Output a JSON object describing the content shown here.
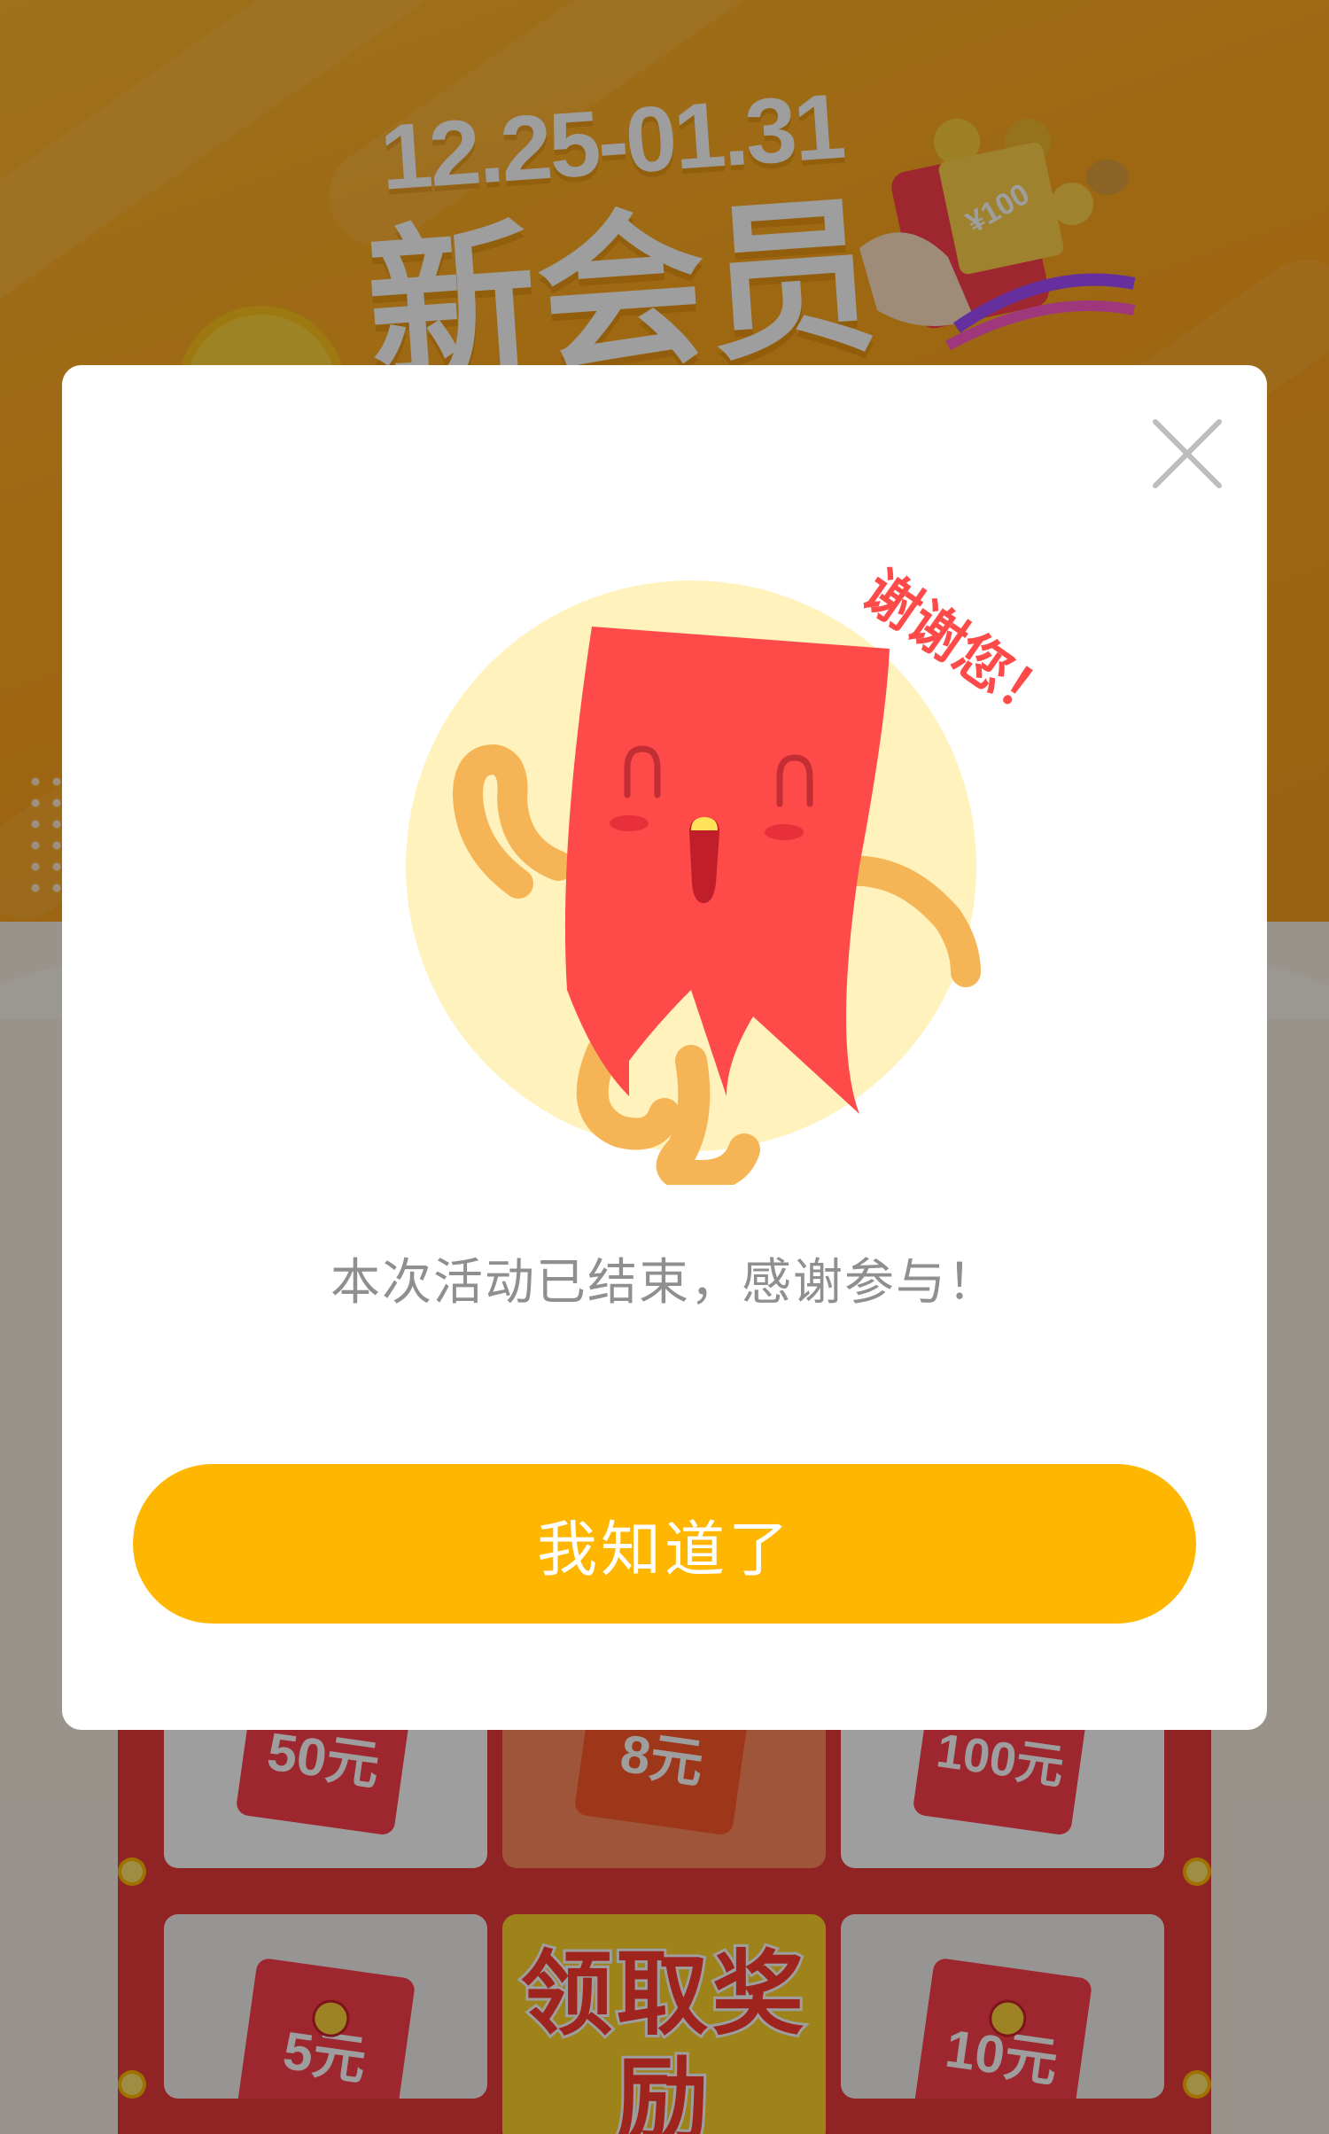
{
  "colors": {
    "modal_bg": "#ffffff",
    "button_bg": "#ffb600",
    "button_text": "#ffffff",
    "message_text": "#8f8f8f",
    "sticker_text": "#ff4a4a",
    "envelope_red": "#ff4a4a",
    "circle_bg": "#fff2bc",
    "limb_color": "#f5b556"
  },
  "background": {
    "date_range": "12.25-01.31",
    "title": "新会员",
    "art_badge": "¥100",
    "tiles": [
      {
        "label": "50元"
      },
      {
        "label": "8元"
      },
      {
        "label": "100元"
      },
      {
        "label": "5元"
      },
      {
        "label": "领取奖励"
      },
      {
        "label": "10元"
      }
    ]
  },
  "modal": {
    "close_icon": "close-icon",
    "sticker_text": "谢谢您！",
    "message": "本次活动已结束，感谢参与！",
    "confirm_label": "我知道了"
  }
}
